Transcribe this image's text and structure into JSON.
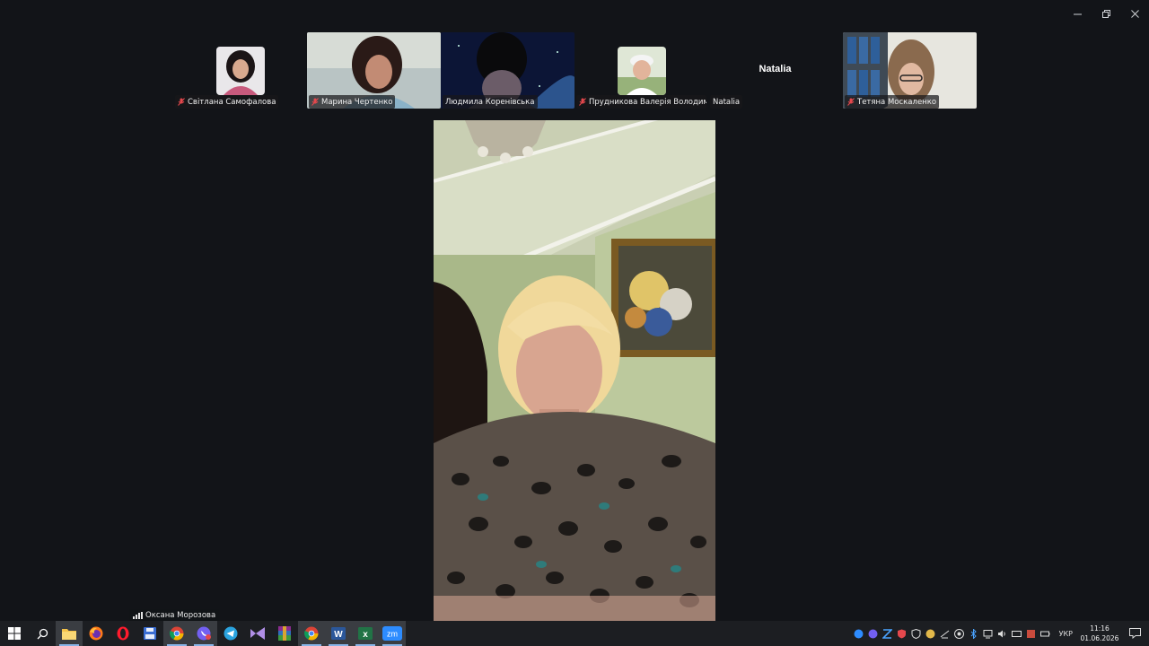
{
  "window": {
    "controls": [
      "minimize",
      "restore",
      "close"
    ]
  },
  "participants": [
    {
      "id": "p1",
      "name": "Світлана Самофалова",
      "muted": true,
      "view": "avatar"
    },
    {
      "id": "p2",
      "name": "Марина Чертенко",
      "muted": true,
      "view": "video"
    },
    {
      "id": "p3",
      "name": "Людмила Коренівська",
      "muted": false,
      "view": "video"
    },
    {
      "id": "p4",
      "name": "Прудникова Валерія Володимир...",
      "muted": true,
      "view": "avatar"
    },
    {
      "id": "p5",
      "name": "Natalia",
      "muted": false,
      "view": "name",
      "display_name": "Natalia"
    },
    {
      "id": "p6",
      "name": "Тетяна Москаленко",
      "muted": true,
      "view": "video"
    }
  ],
  "active_speaker": {
    "name": "Оксана Морозова",
    "signal_icon": "signal-bars-icon"
  },
  "taskbar": {
    "apps": [
      {
        "name": "start",
        "icon": "windows-start-icon"
      },
      {
        "name": "search",
        "icon": "search-icon"
      },
      {
        "name": "file-explorer",
        "icon": "folder-icon",
        "active": true
      },
      {
        "name": "firefox",
        "icon": "firefox-icon"
      },
      {
        "name": "opera",
        "icon": "opera-icon"
      },
      {
        "name": "save",
        "icon": "floppy-icon"
      },
      {
        "name": "chrome-1",
        "icon": "chrome-icon",
        "active": true
      },
      {
        "name": "viber",
        "icon": "viber-icon",
        "active": true
      },
      {
        "name": "telegram",
        "icon": "telegram-icon"
      },
      {
        "name": "visual-studio",
        "icon": "vs-icon"
      },
      {
        "name": "winrar",
        "icon": "winrar-icon"
      },
      {
        "name": "chrome-2",
        "icon": "chrome-icon",
        "active": true
      },
      {
        "name": "word",
        "icon": "word-icon",
        "label": "W",
        "active": true
      },
      {
        "name": "excel",
        "icon": "excel-icon",
        "label": "x",
        "active": true
      },
      {
        "name": "zoom",
        "icon": "zoom-icon",
        "label": "zm",
        "active": true
      }
    ],
    "tray": {
      "language": "УКР",
      "time": "11:16",
      "date": "01.06.2026"
    }
  },
  "colors": {
    "background": "#121418",
    "taskbar": "#1c1e22",
    "accent": "#2d8cff"
  }
}
